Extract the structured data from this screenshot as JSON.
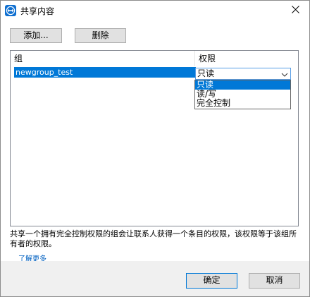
{
  "window": {
    "title": "共享内容",
    "close_glyph": "✕"
  },
  "toolbar": {
    "add_label": "添加...",
    "delete_label": "删除"
  },
  "grid": {
    "columns": [
      {
        "label": "组"
      },
      {
        "label": "权限"
      }
    ],
    "rows": [
      {
        "group": "newgroup_test",
        "permission": "只读"
      }
    ]
  },
  "permission_dropdown": {
    "selected": "只读",
    "options": [
      "只读",
      "读/写",
      "完全控制"
    ]
  },
  "description": {
    "text": "共享一个拥有完全控制权限的组会让联系人获得一个条目的权限，该权限等于该组所有者的权限。",
    "learn_more": "了解更多"
  },
  "footer": {
    "ok_label": "确定",
    "cancel_label": "取消"
  },
  "colors": {
    "accent": "#0078d7",
    "link": "#0060c0",
    "footer_bg": "#f0f0f0",
    "button_bg": "#e1e1e1"
  },
  "icons": {
    "app": "teamviewer-icon",
    "close": "close-icon",
    "chevron": "chevron-down-icon"
  }
}
